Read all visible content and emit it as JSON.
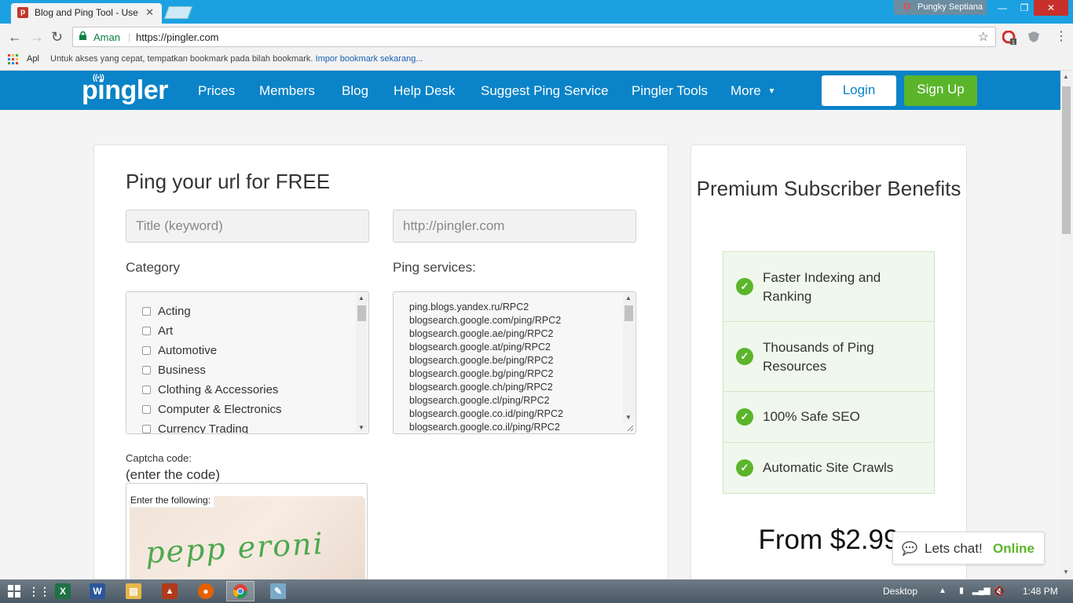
{
  "browser": {
    "tab_title": "Blog and Ping Tool - Use",
    "tab_close": "✕",
    "user_name": "Pungky Septiana",
    "security_label": "Aman",
    "url": "https://pingler.com",
    "bookmarks": {
      "apps_label": "Apl",
      "hint_text": "Untuk akses yang cepat, tempatkan bookmark pada bilah bookmark.",
      "import_link": "Impor bookmark sekarang..."
    }
  },
  "site": {
    "logo": "pingler",
    "nav": [
      {
        "label": "Prices"
      },
      {
        "label": "Members"
      },
      {
        "label": "Blog"
      },
      {
        "label": "Help Desk"
      },
      {
        "label": "Suggest Ping Service"
      },
      {
        "label": "Pingler Tools"
      },
      {
        "label": "More"
      }
    ],
    "login": "Login",
    "signup": "Sign Up"
  },
  "form": {
    "title": "Ping your url for FREE",
    "title_placeholder": "Title (keyword)",
    "url_placeholder": "http://pingler.com",
    "category_label": "Category",
    "services_label": "Ping services:",
    "categories": [
      "Acting",
      "Art",
      "Automotive",
      "Business",
      "Clothing & Accessories",
      "Computer & Electronics",
      "Currency Trading"
    ],
    "services": [
      "ping.blogs.yandex.ru/RPC2",
      "blogsearch.google.com/ping/RPC2",
      "blogsearch.google.ae/ping/RPC2",
      "blogsearch.google.at/ping/RPC2",
      "blogsearch.google.be/ping/RPC2",
      "blogsearch.google.bg/ping/RPC2",
      "blogsearch.google.ch/ping/RPC2",
      "blogsearch.google.cl/ping/RPC2",
      "blogsearch.google.co.id/ping/RPC2",
      "blogsearch.google.co.il/ping/RPC2"
    ],
    "captcha_label": "Captcha code:",
    "captcha_sub": "(enter the code)",
    "captcha_instruction": "Enter the following:",
    "captcha_word": "pepp eroni"
  },
  "sidebar": {
    "title": "Premium Subscriber Benefits",
    "benefits": [
      "Faster Indexing and Ranking",
      "Thousands of Ping Resources",
      "100% Safe SEO",
      "Automatic Site Crawls"
    ],
    "price": "From $2.99"
  },
  "chat": {
    "label": "Lets chat!",
    "status": "Online"
  },
  "taskbar": {
    "desktop_label": "Desktop",
    "clock": "1:48 PM"
  },
  "colors": {
    "brand_blue": "#0a83c8",
    "signup_green": "#5bb52b",
    "chrome_blue": "#1ba1e2"
  }
}
